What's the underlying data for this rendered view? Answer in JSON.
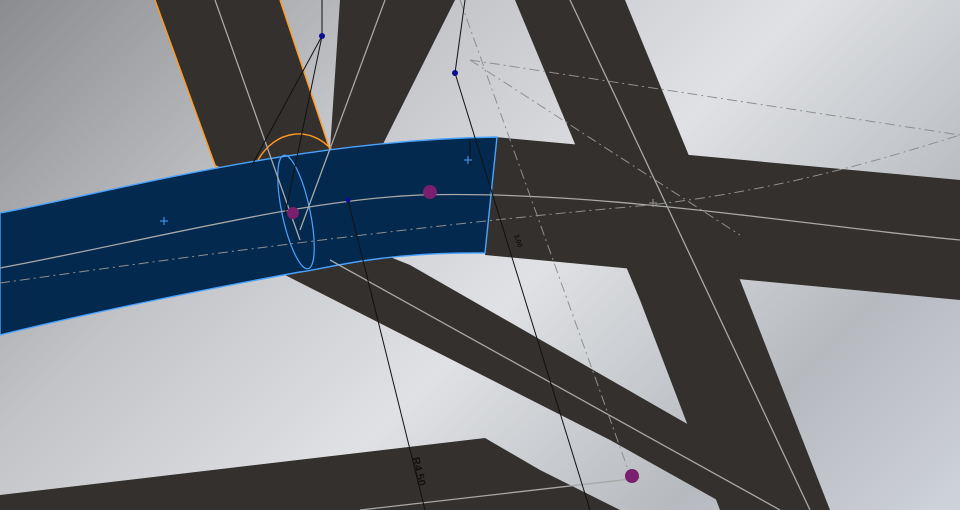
{
  "app": {
    "view": "cad-3d-viewport"
  },
  "colors": {
    "background_light": "#dfe1e4",
    "background_dark": "#8a8c90",
    "member_fill": "#33302d",
    "selected_fill": "#03294f",
    "selected_edge": "#4aa3ff",
    "highlight_edge": "#ff9a1f",
    "centerline": "#a8a8a8",
    "sketch_line": "#111111",
    "sketch_point": "#0a0f8f",
    "weld_point": "#7a1f6e"
  },
  "dimensions": {
    "radius_label": "R4.50",
    "secondary_label": "3.00"
  },
  "icons": {
    "origin_marker": "plus-icon",
    "sketch_point": "sketch-point-icon",
    "weld_node": "weld-node-icon"
  }
}
